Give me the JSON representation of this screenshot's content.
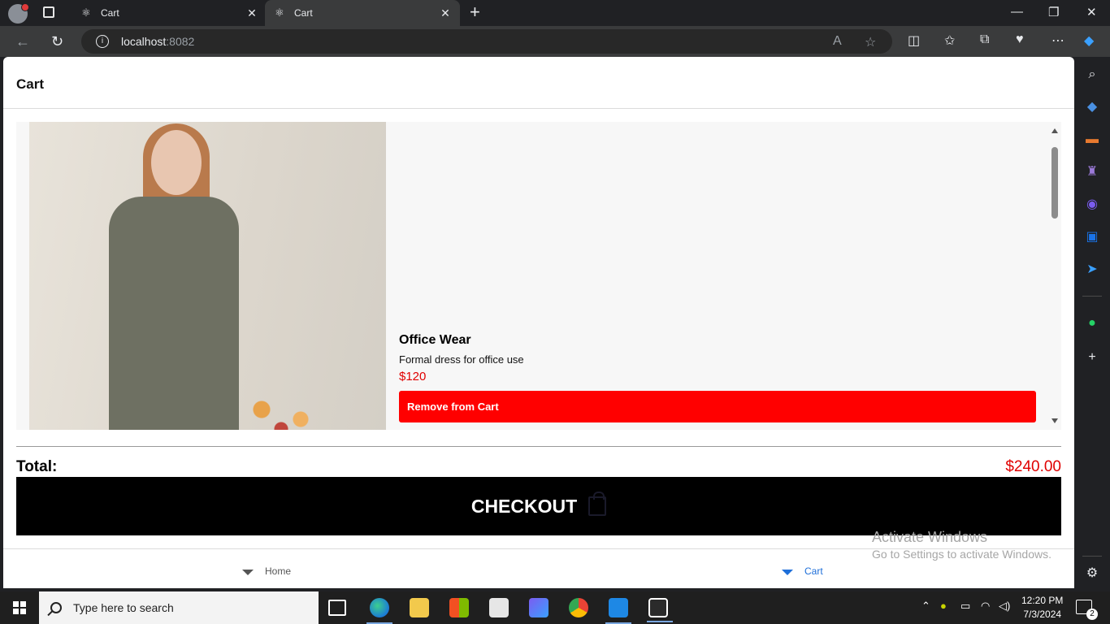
{
  "browser": {
    "tabs": [
      {
        "title": "Cart",
        "active": false
      },
      {
        "title": "Cart",
        "active": true
      }
    ],
    "url_host": "localhost",
    "url_port": ":8082"
  },
  "page": {
    "header_title": "Cart",
    "cart_items": [
      {
        "name": "Office Wear",
        "description": "Formal dress for office use",
        "price": "$120",
        "remove_label": "Remove from Cart"
      }
    ],
    "total_label": "Total:",
    "total_value": "$240.00",
    "checkout_label": "CHECKOUT",
    "nav": [
      {
        "label": "Home",
        "active": false
      },
      {
        "label": "Cart",
        "active": true
      }
    ]
  },
  "watermark": {
    "line1": "Activate Windows",
    "line2": "Go to Settings to activate Windows."
  },
  "taskbar": {
    "search_placeholder": "Type here to search",
    "time": "12:20 PM",
    "date": "7/3/2024",
    "notification_count": "2"
  },
  "colors": {
    "accent_red": "#ff0000",
    "price_red": "#e00000",
    "nav_active_blue": "#1e6fd9",
    "checkout_bg": "#000000"
  }
}
